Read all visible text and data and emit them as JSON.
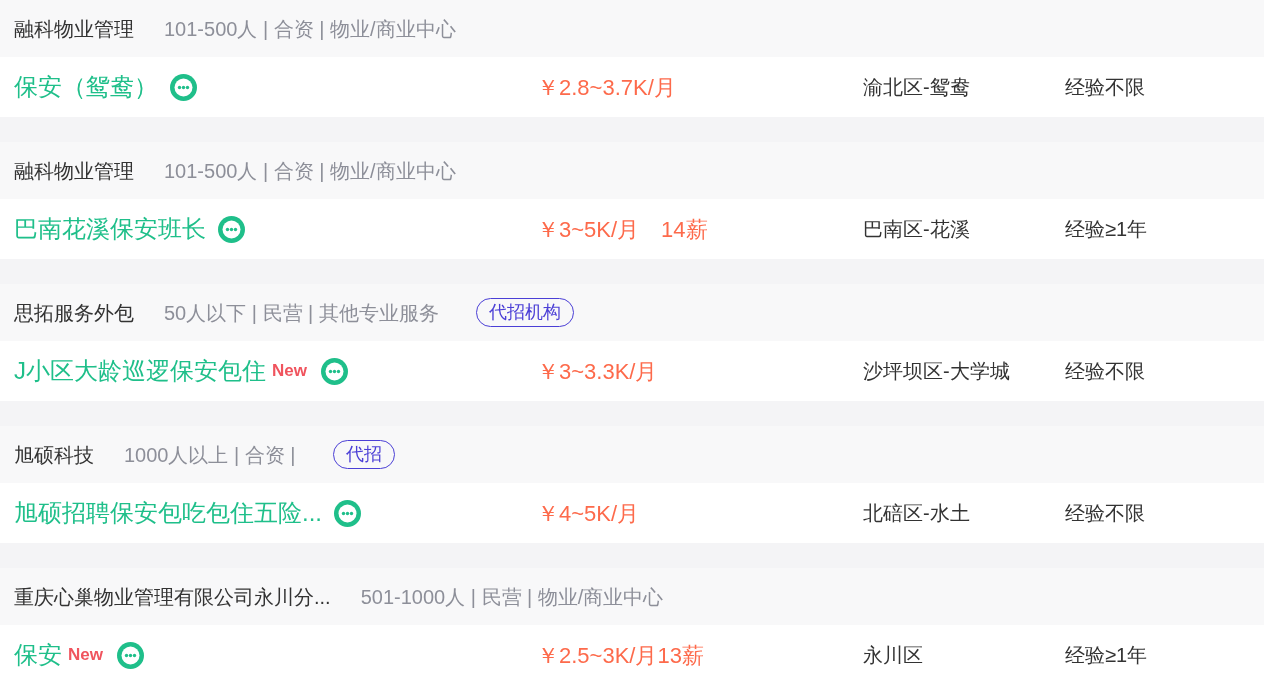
{
  "jobs": [
    {
      "company": "融科物业管理",
      "company_info": "101-500人 | 合资 | 物业/商业中心",
      "title": "保安（鸳鸯）",
      "salary": "￥2.8~3.7K/月",
      "location": "渝北区-鸳鸯",
      "experience": "经验不限"
    },
    {
      "company": "融科物业管理",
      "company_info": "101-500人 | 合资 | 物业/商业中心",
      "title": "巴南花溪保安班长",
      "salary": "￥3~5K/月",
      "bonus": "14薪",
      "location": "巴南区-花溪",
      "experience": "经验≥1年"
    },
    {
      "company": "思拓服务外包",
      "company_info": "50人以下 | 民营 | 其他专业服务",
      "tag": "代招机构",
      "title": "J小区大龄巡逻保安包住",
      "badge": "New",
      "salary": "￥3~3.3K/月",
      "location": "沙坪坝区-大学城",
      "experience": "经验不限"
    },
    {
      "company": "旭硕科技",
      "company_info": "1000人以上 | 合资 |",
      "tag": "代招",
      "title": "旭硕招聘保安包吃包住五险...",
      "salary": "￥4~5K/月",
      "location": "北碚区-水土",
      "experience": "经验不限"
    },
    {
      "company": "重庆心巢物业管理有限公司永川分...",
      "company_info": "501-1000人 | 民营 | 物业/商业中心",
      "title": "保安",
      "badge": "New",
      "salary": "￥2.5~3K/月13薪",
      "location": "永川区",
      "experience": "经验≥1年"
    }
  ]
}
